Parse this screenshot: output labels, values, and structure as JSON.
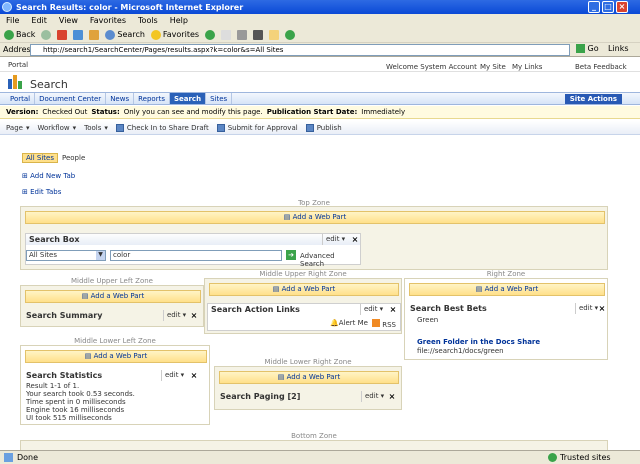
{
  "window": {
    "title": "Search Results: color - Microsoft Internet Explorer"
  },
  "menu": [
    "File",
    "Edit",
    "View",
    "Favorites",
    "Tools",
    "Help"
  ],
  "toolbar": {
    "back": "Back",
    "search": "Search",
    "favorites": "Favorites"
  },
  "address": {
    "label": "Address",
    "url": "http://search1/SearchCenter/Pages/results.aspx?k=color&s=All Sites",
    "go": "Go",
    "links": "Links"
  },
  "portal": {
    "label": "Portal",
    "welcome": "Welcome System Account",
    "my_site": "My Site",
    "my_links": "My Links",
    "beta": "Beta Feedback"
  },
  "site": {
    "title": "Search",
    "site_actions": "Site Actions"
  },
  "nav": [
    "Portal",
    "Document Center",
    "News",
    "Reports",
    "Search",
    "Sites"
  ],
  "page_status": {
    "version_label": "Version:",
    "version": "Checked Out",
    "status_label": "Status:",
    "status": "Only you can see and modify this page.",
    "pub_label": "Publication Start Date:",
    "pub": "Immediately"
  },
  "edit_toolbar": [
    "Page",
    "Workflow",
    "Tools",
    "Check In to Share Draft",
    "Submit for Approval",
    "Publish"
  ],
  "tabs": {
    "all_sites": "All Sites",
    "people": "People",
    "add_tab": "Add New Tab",
    "edit_tabs": "Edit Tabs"
  },
  "zones": {
    "top": "Top Zone",
    "mul": "Middle Upper Left Zone",
    "mur": "Middle Upper Right Zone",
    "right": "Right Zone",
    "mll": "Middle Lower Left Zone",
    "mlr": "Middle Lower Right Zone",
    "bottom": "Bottom Zone"
  },
  "add_web_part": "Add a Web Part",
  "webparts": {
    "search_box": {
      "title": "Search Box",
      "scope": "All Sites",
      "query": "color",
      "advanced": "Advanced Search"
    },
    "summary": {
      "title": "Search Summary"
    },
    "action_links": {
      "title": "Search Action Links",
      "alert": "Alert Me",
      "rss": "RSS"
    },
    "best_bets": {
      "title": "Search Best Bets",
      "keyword": "Green",
      "link": "Green Folder in the Docs Share",
      "path": "file://search1/docs/green"
    },
    "statistics": {
      "title": "Search Statistics",
      "lines": [
        "Result 1-1 of 1.",
        "Your search took 0.53 seconds.",
        "Time spent in 0 milliseconds",
        "Engine took 16 milliseconds",
        "UI took 515 milliseconds"
      ]
    },
    "paging": {
      "title": "Search Paging [2]"
    }
  },
  "edit_label": "edit",
  "statusbar": {
    "done": "Done",
    "zone": "Trusted sites"
  }
}
